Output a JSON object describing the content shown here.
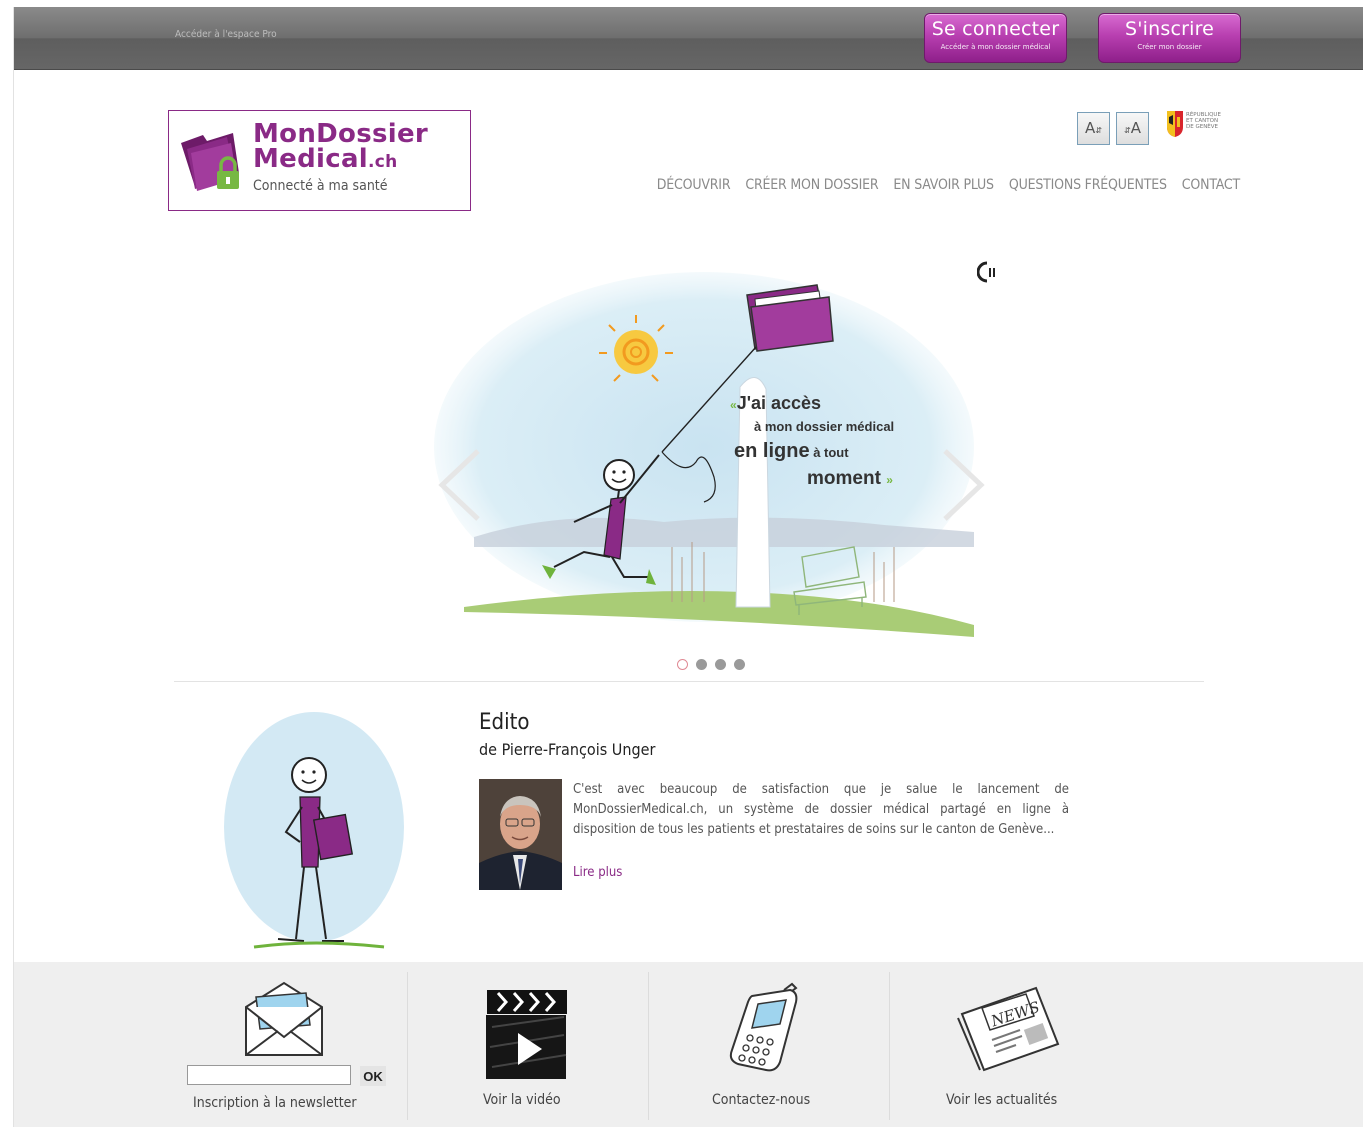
{
  "topbar": {
    "pro_link": "Accéder à l'espace Pro",
    "connect": {
      "title": "Se connecter",
      "subtitle": "Accéder à mon dossier médical"
    },
    "register": {
      "title": "S'inscrire",
      "subtitle": "Créer mon dossier"
    }
  },
  "logo": {
    "line1": "MonDossier",
    "line2": "Medical",
    "line2_suffix": ".ch",
    "tagline": "Connecté à ma santé"
  },
  "accessibility": {
    "decrease": "A",
    "increase": "A"
  },
  "canton": {
    "line1": "RÉPUBLIQUE",
    "line2": "ET CANTON",
    "line3": "DE GENÈVE"
  },
  "nav": [
    "DÉCOUVRIR",
    "CRÉER MON DOSSIER",
    "EN SAVOIR PLUS",
    "QUESTIONS FRÉQUENTES",
    "CONTACT"
  ],
  "slider": {
    "quote_open": "«",
    "quote_close": "»",
    "line1": "J'ai accès",
    "line2": "à mon dossier médical",
    "line3_big": "en ligne",
    "line3_small": " à tout",
    "line4": "moment",
    "slide_count": 4,
    "active_slide": 1
  },
  "edito": {
    "title": "Edito",
    "subtitle": "de Pierre-François Unger",
    "text": "C'est avec beaucoup de satisfaction que je salue le lancement de MonDossierMedical.ch, un système de dossier médical partagé en ligne à disposition de tous les patients et prestataires de soins sur le canton de Genève...",
    "read_more": "Lire plus"
  },
  "footer": {
    "newsletter_ok": "OK",
    "newsletter_label": "Inscription à la newsletter",
    "video_label": "Voir la vidéo",
    "contact_label": "Contactez-nous",
    "news_label": "Voir les actualités",
    "news_sign": "NEWS"
  },
  "colors": {
    "brand": "#8a2a86",
    "green": "#77b843",
    "topbar": "#6e6e6e"
  }
}
